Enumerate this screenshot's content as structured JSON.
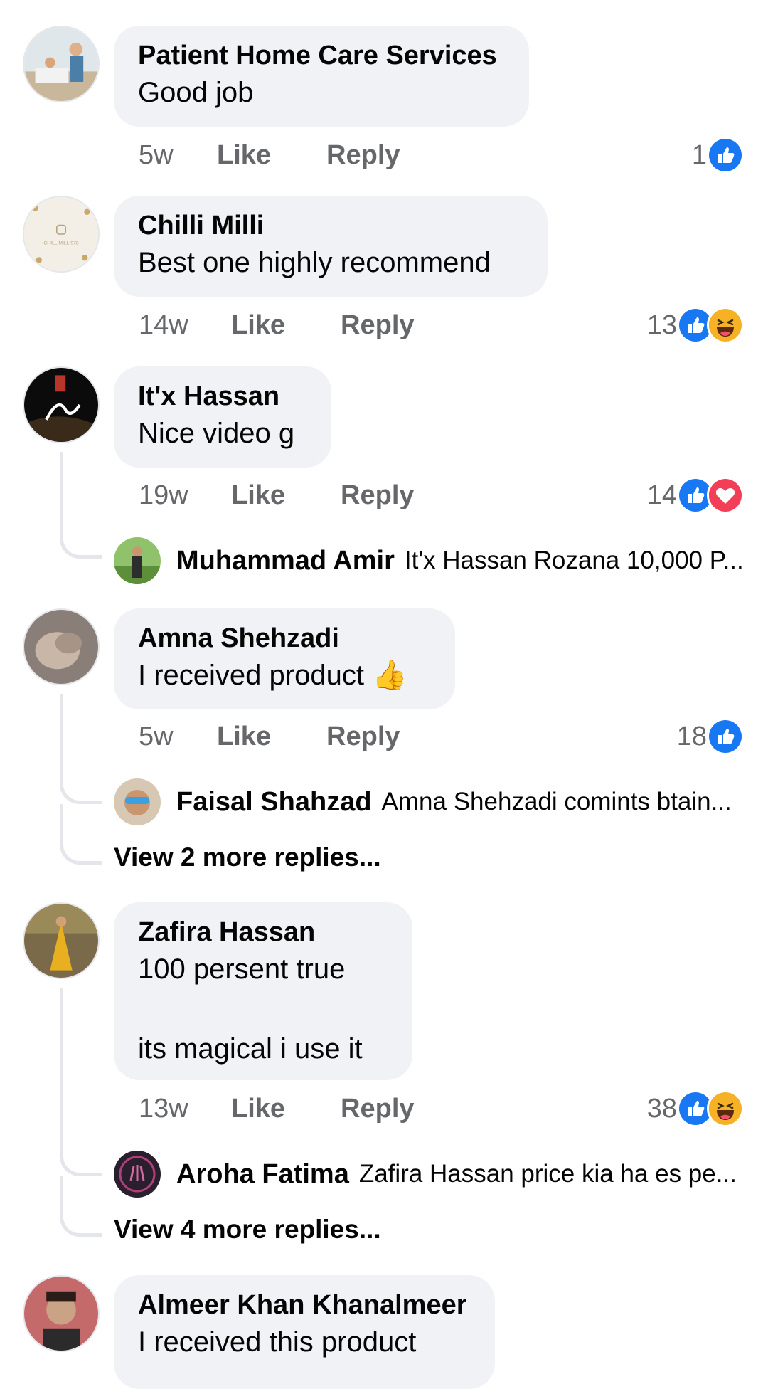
{
  "comments": [
    {
      "name": "Patient Home Care Services",
      "text": "Good job",
      "time": "5w",
      "like_label": "Like",
      "reply_label": "Reply",
      "reaction_count": "1",
      "reactions": [
        "like-icon"
      ]
    },
    {
      "name": "Chilli Milli",
      "avatar_text": "CHILLIMILLI978",
      "text": "Best one highly recommend",
      "time": "14w",
      "like_label": "Like",
      "reply_label": "Reply",
      "reaction_count": "13",
      "reactions": [
        "like-icon",
        "haha-icon"
      ]
    },
    {
      "name": "It'x Hassan",
      "text": "Nice video g",
      "time": "19w",
      "like_label": "Like",
      "reply_label": "Reply",
      "reaction_count": "14",
      "reactions": [
        "like-icon",
        "love-icon"
      ],
      "reply_preview": {
        "name": "Muhammad Amir",
        "text": "It'x Hassan Rozana 10,000 P..."
      }
    },
    {
      "name": "Amna Shehzadi",
      "text": "I received product 👍",
      "time": "5w",
      "like_label": "Like",
      "reply_label": "Reply",
      "reaction_count": "18",
      "reactions": [
        "like-icon"
      ],
      "reply_preview": {
        "name": "Faisal Shahzad",
        "text": "Amna Shehzadi comints btain..."
      },
      "more_replies": "View 2 more replies..."
    },
    {
      "name": "Zafira Hassan",
      "text": "100 persent true\n\nits magical i use it",
      "time": "13w",
      "like_label": "Like",
      "reply_label": "Reply",
      "reaction_count": "38",
      "reactions": [
        "like-icon",
        "haha-icon"
      ],
      "reply_preview": {
        "name": "Aroha Fatima",
        "text": "Zafira Hassan price kia ha es pe..."
      },
      "more_replies": "View 4 more replies..."
    },
    {
      "name": "Almeer Khan Khanalmeer",
      "text": "I received this product"
    }
  ],
  "colors": {
    "like_blue": "#1877f2",
    "love_red": "#f33e58",
    "haha_yellow": "#f7b125",
    "bubble_bg": "#f0f2f5",
    "meta_gray": "#65676b"
  }
}
